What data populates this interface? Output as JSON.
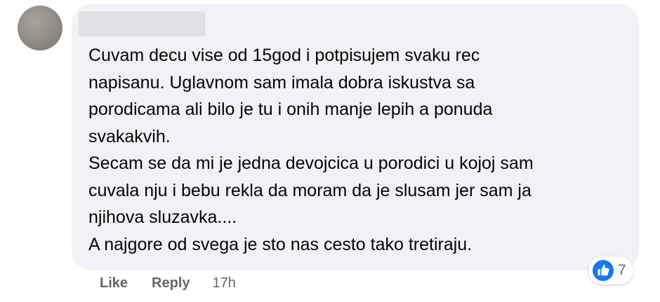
{
  "comment": {
    "author_name": "",
    "lines": [
      "Cuvam decu vise od 15god i potpisujem svaku rec",
      "napisanu. Uglavnom sam imala dobra iskustva sa",
      "porodicama ali bilo je tu i onih manje lepih a ponuda",
      "svakakvih.",
      "Secam se da mi je jedna devojcica u porodici u kojoj sam",
      "cuvala nju i bebu rekla da moram da je slusam jer sam ja",
      "njihova sluzavka....",
      "A najgore od svega je sto nas cesto tako tretiraju."
    ],
    "reactions": {
      "icon": "like-icon",
      "count": "7",
      "color": "#1877f2"
    }
  },
  "actions": {
    "like_label": "Like",
    "reply_label": "Reply",
    "timestamp": "17h"
  },
  "colors": {
    "bubble": "#f0f2f5",
    "text": "#050505",
    "secondary_text": "#65676b",
    "like_blue": "#1877f2"
  }
}
